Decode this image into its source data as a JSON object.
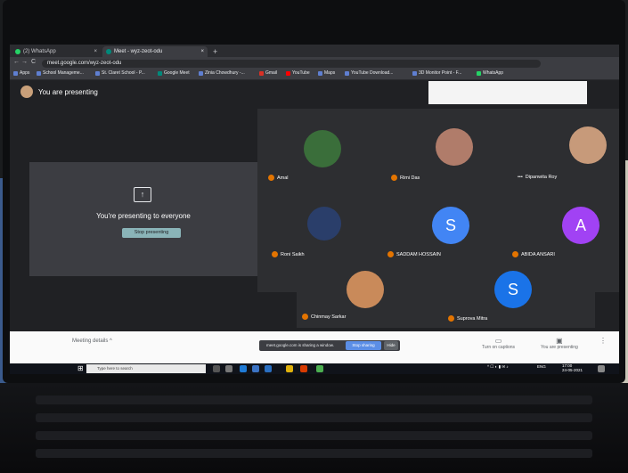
{
  "browser": {
    "tabs": [
      {
        "label": "(2) WhatsApp",
        "close": "×"
      },
      {
        "label": "Meet - wyz-zeot-odu",
        "close": "×"
      }
    ],
    "new_tab": "+",
    "url": "meet.google.com/wyz-zeot-odu",
    "nav": {
      "back": "←",
      "forward": "→",
      "reload": "C"
    },
    "bookmarks": [
      "Apps",
      "School Manageme...",
      "St. Claret School - P...",
      "Google Meet",
      "Zinia Chowdhury -...",
      "Gmail",
      "YouTube",
      "Maps",
      "YouTube Download...",
      "3D Monitor Point - F...",
      "WhatsApp"
    ]
  },
  "meet": {
    "presenting_label": "You are presenting",
    "stage_message": "You're presenting to everyone",
    "stop_button": "Stop presenting",
    "participants": [
      {
        "name": "Amal",
        "initial": "",
        "color": "#3a6e3a"
      },
      {
        "name": "Rimi Das",
        "initial": "",
        "color": "#b07c6a"
      },
      {
        "name": "Dipanwita Roy",
        "initial": "",
        "color": "#c79a7a"
      },
      {
        "name": "Roni Saikh",
        "initial": "",
        "color": "#2a3e6a"
      },
      {
        "name": "SADDAM HOSSAIN",
        "initial": "S",
        "color": "#4285f4"
      },
      {
        "name": "ABIDA ANSARI",
        "initial": "A",
        "color": "#a142f4"
      },
      {
        "name": "Chinmay Sarkar",
        "initial": "",
        "color": "#c98a5a"
      },
      {
        "name": "Suprova Mitra",
        "initial": "S",
        "color": "#1a73e8"
      }
    ],
    "more_label": "•••",
    "meeting_details": "Meeting details",
    "share_note": "meet.google.com is sharing a window.",
    "share_stop": "Stop sharing",
    "share_hide": "Hide",
    "captions_label": "Turn on captions",
    "presenting_status": "You are presenting"
  },
  "taskbar": {
    "search_placeholder": "Type here to search",
    "lang": "ENG",
    "time": "17:00",
    "date": "24-05-2021"
  }
}
